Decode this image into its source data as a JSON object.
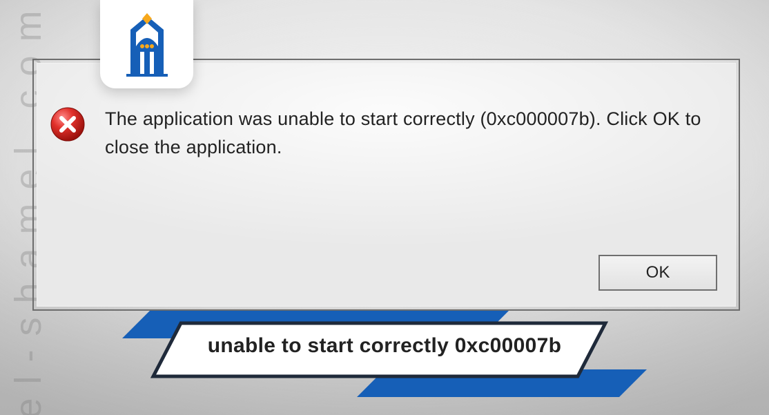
{
  "watermark": {
    "text": "el-shamel.com"
  },
  "dialog": {
    "message": "The application was unable to start correctly (0xc000007b). Click OK to close the application.",
    "ok_label": "OK"
  },
  "banner": {
    "title": "unable to start correctly 0xc00007b"
  },
  "colors": {
    "brand_blue": "#165fb7",
    "brand_orange": "#f7a81b"
  }
}
